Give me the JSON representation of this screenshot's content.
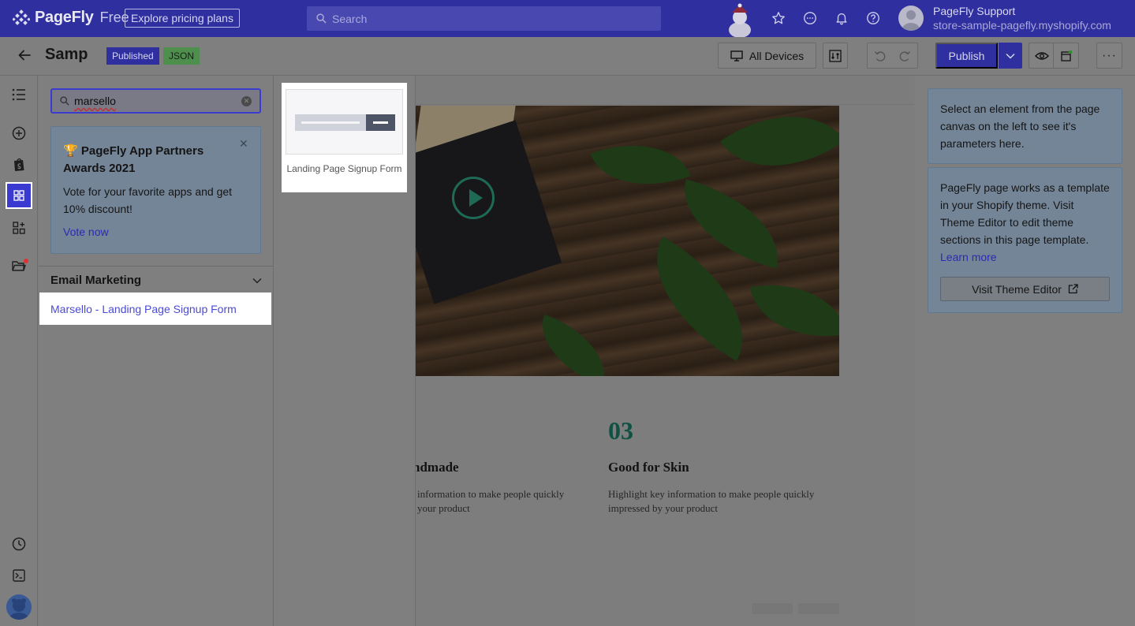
{
  "topbar": {
    "brand": "PageFly",
    "plan": "Free",
    "explore_label": "Explore pricing plans",
    "search_placeholder": "Search",
    "user_name": "PageFly Support",
    "user_store": "store-sample-pagefly.myshopify.com",
    "icons": [
      "star-icon",
      "chat-icon",
      "bell-icon",
      "help-icon"
    ]
  },
  "toolbar": {
    "page_name": "Samp",
    "status_badge": "Published",
    "type_badge": "JSON",
    "devices_label": "All Devices",
    "publish_label": "Publish"
  },
  "rail": {
    "items": [
      "outline-icon",
      "add-element-icon",
      "shopify-icon",
      "templates-icon",
      "apps-icon",
      "folder-icon",
      "history-icon",
      "code-icon"
    ]
  },
  "left_panel": {
    "search_value": "marsello",
    "promo": {
      "title": "🏆 PageFly App Partners Awards 2021",
      "body": "Vote for your favorite apps and get 10% discount!",
      "link": "Vote now"
    },
    "section_title": "Email Marketing",
    "result_item": "Marsello - Landing Page Signup Form"
  },
  "preview": {
    "caption": "Landing Page Signup Form"
  },
  "canvas": {
    "feature_left_title": "ndmade",
    "feature_left_desc_line1": "information to make people quickly",
    "feature_left_desc_line2": "your product",
    "feature_number": "03",
    "feature_title": "Good for Skin",
    "feature_desc_line1": "Highlight key information to make people quickly",
    "feature_desc_line2": "impressed by your product"
  },
  "right_panel": {
    "select_hint": "Select an element from the page canvas on the left to see it's parameters here.",
    "template_info": "PageFly page works as a template in your Shopify theme. Visit Theme Editor to edit theme sections in this page template.",
    "learn_more": "Learn more",
    "theme_button": "Visit Theme Editor"
  },
  "colors": {
    "brand": "#2f2f9f",
    "accent": "#3a3ad0",
    "overlay_gray": "#7f7f7f"
  }
}
